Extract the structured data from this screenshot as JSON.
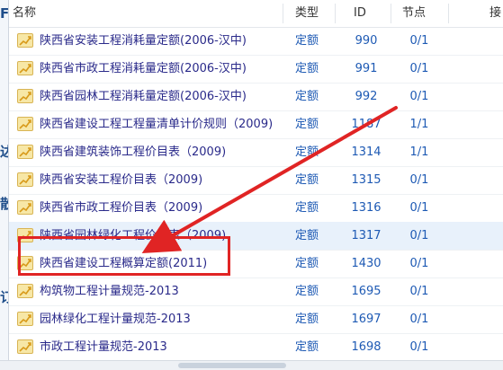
{
  "header": {
    "col_name": "名称",
    "col_type": "类型",
    "col_id": "ID",
    "col_node": "节点",
    "col_action": "接"
  },
  "left_strip": [
    "F",
    "达",
    "散",
    "订"
  ],
  "rows": [
    {
      "name": "陕西省安装工程消耗量定额(2006-汉中)",
      "type": "定额",
      "id": "990",
      "node": "0/1"
    },
    {
      "name": "陕西省市政工程消耗量定额(2006-汉中)",
      "type": "定额",
      "id": "991",
      "node": "0/1"
    },
    {
      "name": "陕西省园林工程消耗量定额(2006-汉中)",
      "type": "定额",
      "id": "992",
      "node": "0/1"
    },
    {
      "name": "陕西省建设工程工程量清单计价规则（2009)",
      "type": "定额",
      "id": "1187",
      "node": "1/1"
    },
    {
      "name": "陕西省建筑装饰工程价目表（2009)",
      "type": "定额",
      "id": "1314",
      "node": "1/1"
    },
    {
      "name": "陕西省安装工程价目表（2009)",
      "type": "定额",
      "id": "1315",
      "node": "0/1"
    },
    {
      "name": "陕西省市政工程价目表（2009)",
      "type": "定额",
      "id": "1316",
      "node": "0/1"
    },
    {
      "name": "陕西省园林绿化工程价目表（2009)",
      "type": "定额",
      "id": "1317",
      "node": "0/1"
    },
    {
      "name": "陕西省建设工程概算定额(2011)",
      "type": "定额",
      "id": "1430",
      "node": "0/1"
    },
    {
      "name": "构筑物工程计量规范-2013",
      "type": "定额",
      "id": "1695",
      "node": "0/1"
    },
    {
      "name": "园林绿化工程计量规范-2013",
      "type": "定额",
      "id": "1697",
      "node": "0/1"
    },
    {
      "name": "市政工程计量规范-2013",
      "type": "定额",
      "id": "1698",
      "node": "0/1"
    }
  ],
  "highlighted_row": 8,
  "hover_row": 7,
  "colors": {
    "annotation": "#e02424",
    "hover": "#e8f1fb",
    "link": "#1e5ab4"
  },
  "icons": {
    "row_icon": "chart-trend-icon"
  }
}
